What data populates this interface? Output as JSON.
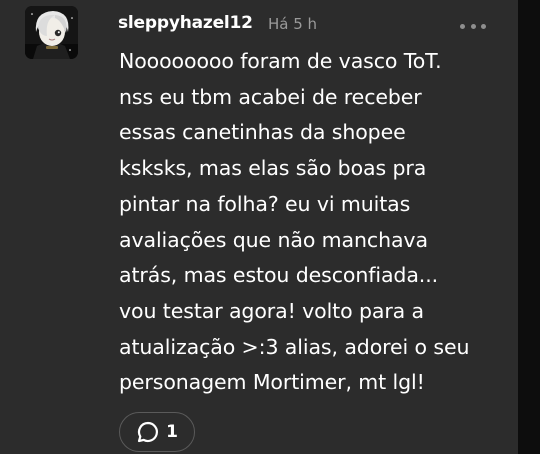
{
  "comment": {
    "username": "sleppyhazel12",
    "timestamp": "Há 5 h",
    "body_lines": [
      "Noooooooo foram de vasco ToT.",
      "nss eu tbm acabei de receber",
      "essas canetinhas da shopee",
      "ksksks, mas elas são boas pra",
      "pintar na folha? eu vi muitas",
      "avaliações que não manchava",
      "atrás, mas estou desconfiada...",
      "vou testar agora! volto para a",
      "atualização >:3 alias, adorei o seu",
      "personagem Mortimer, mt lgl!"
    ],
    "reply_count": "1",
    "avatar_icon": "avatar-character-icon",
    "more_icon": "more-dots-icon",
    "reply_icon": "speech-bubble-icon"
  },
  "colors": {
    "card_background": "#2c2c2c",
    "page_background": "#000000",
    "text_primary": "#ffffff",
    "text_secondary": "#9a9a9a",
    "pill_border": "#5a5a5a"
  }
}
